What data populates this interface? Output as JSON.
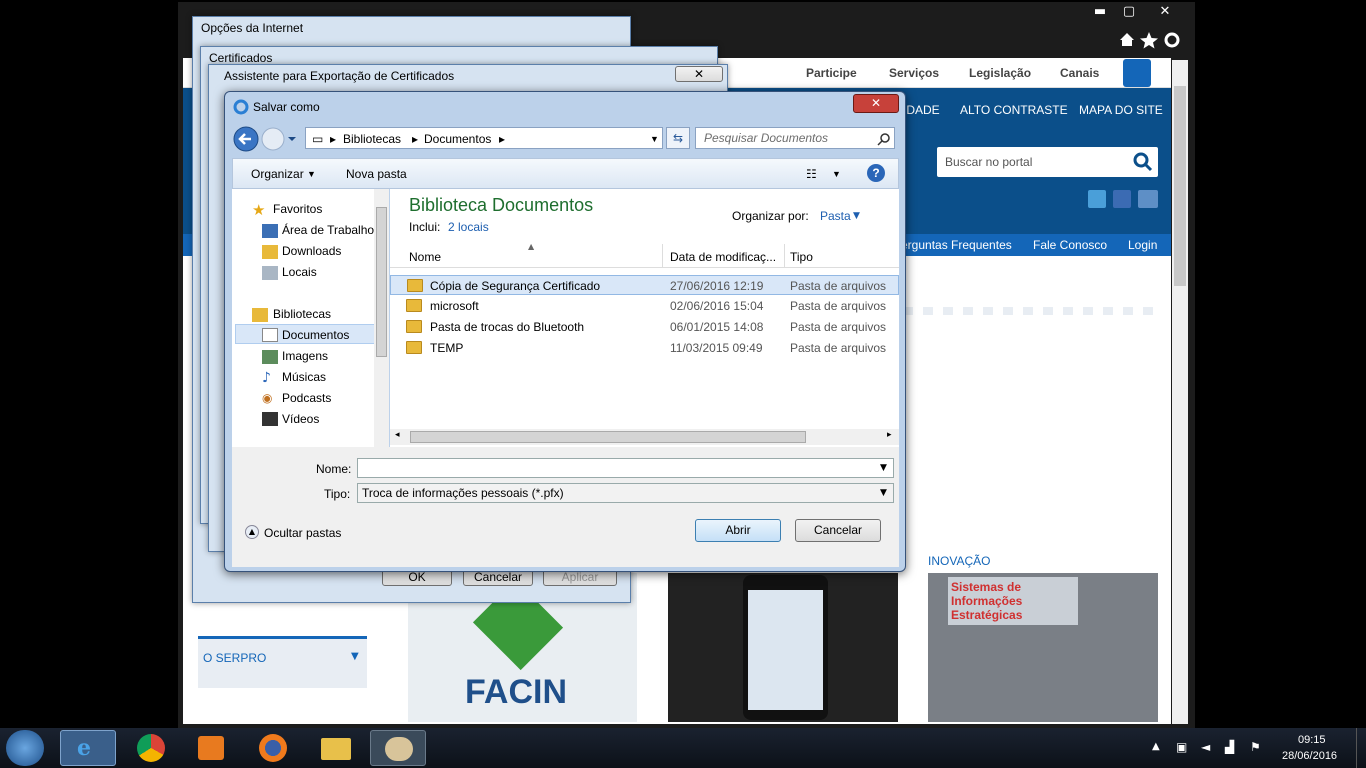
{
  "browser": {
    "controls": {
      "minimize": "▬",
      "maximize": "▢",
      "close": "✕"
    },
    "site": {
      "topnav": [
        "Participe",
        "Serviços",
        "Legislação",
        "Canais"
      ],
      "header_links": [
        "IDADE",
        "ALTO CONTRASTE",
        "MAPA DO SITE"
      ],
      "search_placeholder": "Buscar no portal",
      "subnav": [
        "erguntas Frequentes",
        "Fale Conosco",
        "Login"
      ],
      "section_label": "INOVAÇÃO",
      "sidebar_menu": "O SERPRO",
      "promo_text": "Sistemas de Informações Estratégicas",
      "facin_label": "FACIN"
    }
  },
  "dialogs": {
    "internet_options": {
      "title": "Opções da Internet",
      "buttons": {
        "ok": "OK",
        "cancel": "Cancelar",
        "apply": "Aplicar"
      }
    },
    "certificates": {
      "title": "Certificados"
    },
    "export_wizard": {
      "title": "Assistente para Exportação de Certificados"
    },
    "save_as": {
      "title": "Salvar como",
      "address": {
        "part1": "Bibliotecas",
        "part2": "Documentos"
      },
      "search_placeholder": "Pesquisar Documentos",
      "toolbar": {
        "organize": "Organizar",
        "new_folder": "Nova pasta"
      },
      "nav": {
        "favorites": "Favoritos",
        "desktop": "Área de Trabalho",
        "downloads": "Downloads",
        "places": "Locais",
        "libraries": "Bibliotecas",
        "documents": "Documentos",
        "images": "Imagens",
        "music": "Músicas",
        "podcasts": "Podcasts",
        "videos": "Vídeos"
      },
      "library": {
        "title": "Biblioteca Documentos",
        "includes_label": "Inclui:",
        "includes_link": "2 locais",
        "arrange_label": "Organizar por:",
        "arrange_value": "Pasta"
      },
      "columns": {
        "name": "Nome",
        "date": "Data de modificaç...",
        "type": "Tipo"
      },
      "files": [
        {
          "name": "Cópia de Segurança Certificado",
          "date": "27/06/2016 12:19",
          "type": "Pasta de arquivos"
        },
        {
          "name": "microsoft",
          "date": "02/06/2016 15:04",
          "type": "Pasta de arquivos"
        },
        {
          "name": "Pasta de trocas do Bluetooth",
          "date": "06/01/2015 14:08",
          "type": "Pasta de arquivos"
        },
        {
          "name": "TEMP",
          "date": "11/03/2015 09:49",
          "type": "Pasta de arquivos"
        }
      ],
      "filename_label": "Nome:",
      "filename_value": "",
      "filetype_label": "Tipo:",
      "filetype_value": "Troca de informações pessoais (*.pfx)",
      "hide_folders": "Ocultar pastas",
      "open_button": "Abrir",
      "cancel_button": "Cancelar"
    }
  },
  "taskbar": {
    "time": "09:15",
    "date": "28/06/2016"
  }
}
